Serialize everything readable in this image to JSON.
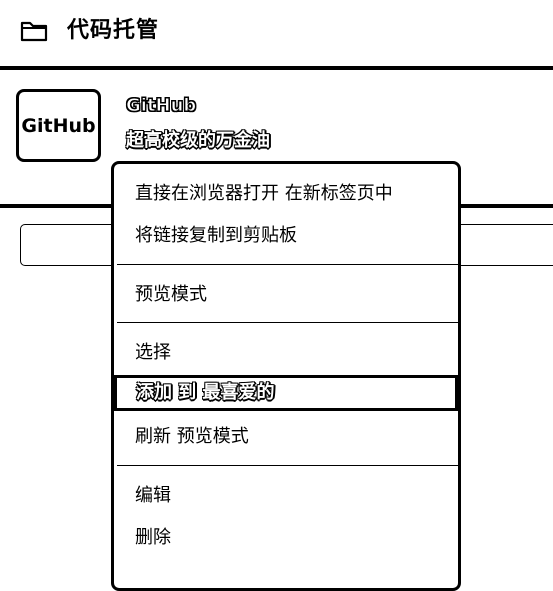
{
  "header": {
    "title": "代码托管",
    "icon": "folder-icon"
  },
  "app": {
    "logo_text": "GitHub",
    "name": "GitHub",
    "description": "超高校级的万金油"
  },
  "search": {
    "value": ""
  },
  "context_menu": {
    "items": [
      {
        "label": "直接在浏览器打开 在新标签页中"
      },
      {
        "label": "将链接复制到剪贴板"
      },
      {
        "label": "预览模式"
      },
      {
        "label": "选择"
      },
      {
        "label": "添加 到 最喜爱的",
        "highlighted": true
      },
      {
        "label": "刷新 预览模式"
      },
      {
        "label": "编辑"
      },
      {
        "label": "删除"
      }
    ]
  }
}
